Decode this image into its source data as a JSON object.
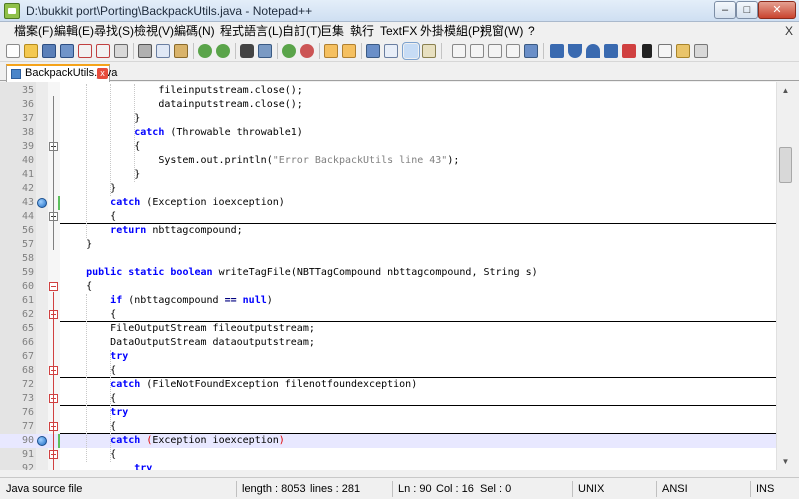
{
  "window": {
    "title": "D:\\bukkit port\\Porting\\BackpackUtils.java - Notepad++",
    "min_glyph": "–",
    "max_glyph": "□",
    "close_glyph": "✕"
  },
  "menu": {
    "items": [
      "檔案(F)",
      "編輯(E)",
      "尋找(S)",
      "檢視(V)",
      "編碼(N)",
      "程式語言(L)",
      "自訂(T)",
      "巨集",
      "執行",
      "TextFX",
      "外掛模組(P)",
      "視窗(W)",
      "?"
    ],
    "close_glyph": "X"
  },
  "toolbar": {
    "icons": [
      "new-file-icon",
      "open-file-icon",
      "save-icon",
      "save-all-icon",
      "close-icon",
      "close-all-icon",
      "print-icon",
      "cut-icon",
      "copy-icon",
      "paste-icon",
      "undo-icon",
      "redo-icon",
      "find-icon",
      "replace-icon",
      "zoom-in-icon",
      "zoom-out-icon",
      "sync-vertical-icon",
      "sync-horizontal-icon",
      "word-wrap-icon",
      "show-all-chars-icon",
      "indent-guide-icon",
      "user-lang-icon",
      "record-macro-icon",
      "stop-macro-icon",
      "play-macro-icon",
      "run-macro-icon",
      "save-macro-icon",
      "trim-icon",
      "collapse-icon",
      "expand-icon",
      "function-icon",
      "hex-icon",
      "comment-icon",
      "clipboard-icon",
      "compare-icon"
    ]
  },
  "tab": {
    "label": "BackpackUtils.java",
    "close_glyph": "x",
    "accent_color": "#f5a31a"
  },
  "editor": {
    "lines": [
      {
        "num": "35",
        "code": "                fileinputstream.close();"
      },
      {
        "num": "36",
        "code": "                datainputstream.close();"
      },
      {
        "num": "37",
        "code": "            }"
      },
      {
        "num": "38",
        "code": "            catch (Throwable throwable1)"
      },
      {
        "num": "39",
        "code": "            {"
      },
      {
        "num": "40",
        "code": "                System.out.println(\"Error BackpackUtils line 43\");"
      },
      {
        "num": "41",
        "code": "            }"
      },
      {
        "num": "42",
        "code": "        }"
      },
      {
        "num": "43",
        "code": "        catch (Exception ioexception)"
      },
      {
        "num": "44",
        "code": "        {"
      },
      {
        "num": "56",
        "code": "        return nbttagcompound;"
      },
      {
        "num": "57",
        "code": "    }"
      },
      {
        "num": "58",
        "code": ""
      },
      {
        "num": "59",
        "code": "    public static boolean writeTagFile(NBTTagCompound nbttagcompound, String s)"
      },
      {
        "num": "60",
        "code": "    {"
      },
      {
        "num": "61",
        "code": "        if (nbttagcompound == null)"
      },
      {
        "num": "62",
        "code": "        {"
      },
      {
        "num": "65",
        "code": "        FileOutputStream fileoutputstream;"
      },
      {
        "num": "66",
        "code": "        DataOutputStream dataoutputstream;"
      },
      {
        "num": "67",
        "code": "        try"
      },
      {
        "num": "68",
        "code": "        {"
      },
      {
        "num": "72",
        "code": "        catch (FileNotFoundException filenotfoundexception)"
      },
      {
        "num": "73",
        "code": "        {"
      },
      {
        "num": "76",
        "code": "        try"
      },
      {
        "num": "77",
        "code": "        {"
      },
      {
        "num": "90",
        "code": "        catch (Exception ioexception)"
      },
      {
        "num": "91",
        "code": "        {"
      },
      {
        "num": "92",
        "code": "            try"
      }
    ],
    "current_line": "90",
    "bookmarked_lines": [
      "43",
      "90"
    ],
    "colors": {
      "keyword": "#0000ff",
      "type": "#8000ff",
      "string": "#808080",
      "brace_match": "#e00000",
      "current_line_bg": "#e8e8ff"
    }
  },
  "status": {
    "language": "Java source file",
    "length": "length : 8053",
    "lines": "lines : 281",
    "ln": "Ln : 90",
    "col": "Col : 16",
    "sel": "Sel : 0",
    "eol": "UNIX",
    "encoding": "ANSI",
    "mode": "INS"
  }
}
